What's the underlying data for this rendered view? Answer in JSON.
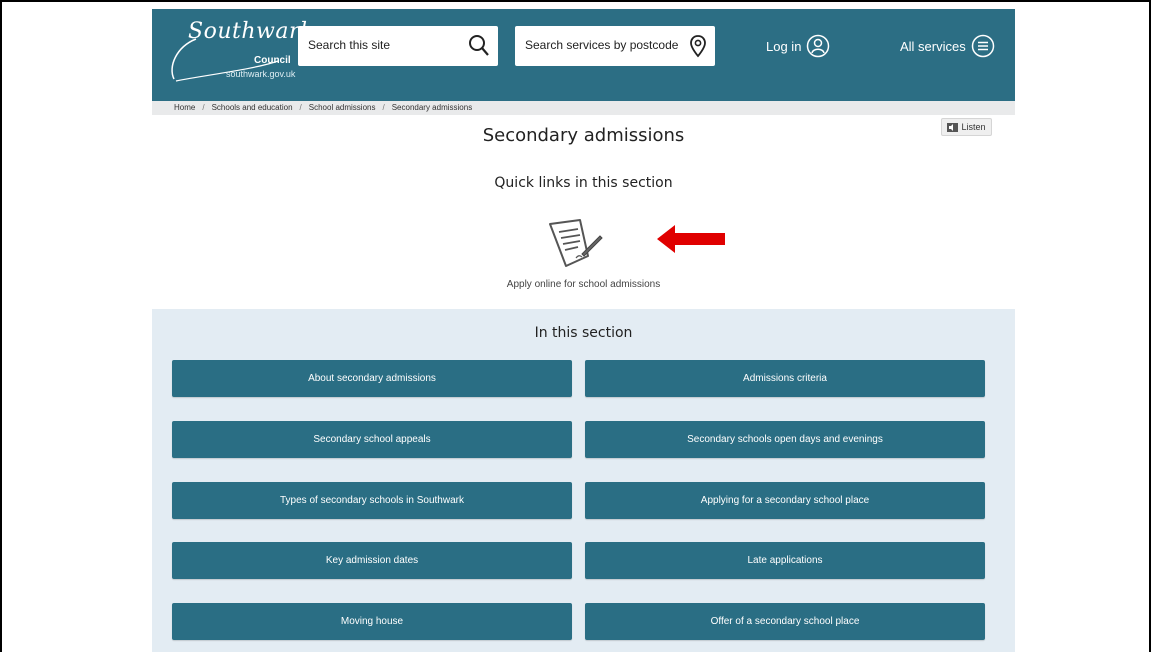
{
  "header": {
    "logo_word": "Southwark",
    "logo_council": "Council",
    "logo_url": "southwark.gov.uk",
    "search_site_placeholder": "Search this site",
    "search_postcode_placeholder": "Search services by postcode",
    "login_label": "Log in",
    "all_services_label": "All services",
    "brand_color": "#2c6e84"
  },
  "breadcrumb": [
    "Home",
    "Schools and education",
    "School admissions",
    "Secondary admissions"
  ],
  "listen_label": "Listen",
  "page_title": "Secondary admissions",
  "quick_links": {
    "title": "Quick links in this section",
    "items": [
      {
        "label": "Apply online for school admissions",
        "icon": "form-pen-icon"
      }
    ]
  },
  "section": {
    "title": "In this section",
    "tiles": [
      "About secondary admissions",
      "Admissions criteria",
      "Secondary school appeals",
      "Secondary schools open days and evenings",
      "Types of secondary schools in Southwark",
      "Applying for a secondary school place",
      "Key admission dates",
      "Late applications",
      "Moving house",
      "Offer of a secondary school place"
    ]
  },
  "annotation": {
    "icon": "red-arrow-icon",
    "color": "#e00000"
  }
}
